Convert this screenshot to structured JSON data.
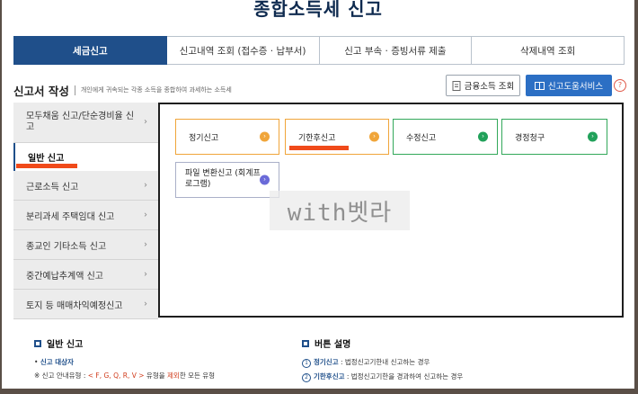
{
  "page_title": "종합소득세 신고",
  "tabs": [
    {
      "label": "세금신고"
    },
    {
      "label": "신고내역 조회 (접수증 · 납부서)"
    },
    {
      "label": "신고 부속 · 증빙서류 제출"
    },
    {
      "label": "삭제내역 조회"
    }
  ],
  "section": {
    "title": "신고서 작성",
    "desc": "개인에게 귀속되는 각종 소득을 종합하여 과세하는 소득세"
  },
  "buttons": {
    "financial_income": "금융소득 조회",
    "help_service": "신고도움서비스",
    "help_icon": "?"
  },
  "sidebar": {
    "items": [
      {
        "label": "모두채움 신고/단순경비율 신고"
      },
      {
        "label": "일반 신고"
      },
      {
        "label": "근로소득 신고"
      },
      {
        "label": "분리과세 주택임대 신고"
      },
      {
        "label": "종교인 기타소득 신고"
      },
      {
        "label": "중간예납추계액 신고"
      },
      {
        "label": "토지 등 매매차익예정신고"
      }
    ]
  },
  "options": [
    {
      "label": "정기신고"
    },
    {
      "label": "기한후신고"
    },
    {
      "label": "수정신고"
    },
    {
      "label": "경정청구"
    },
    {
      "label": "파일 변환신고 (회계프로그램)"
    }
  ],
  "watermark": "with벳라",
  "info_left": {
    "title": "일반 신고",
    "line1": "신고 대상자",
    "line2_pre": "※ 신고 안내유형 : ",
    "line2_codes": "< F, G, Q, R, V >",
    "line2_mid": " 유형을 ",
    "line2_red": "제외",
    "line2_post": "한 모든 유형"
  },
  "info_right": {
    "title": "버튼 설명",
    "line1_num": "1",
    "line1_b": "정기신고",
    "line1": " : 법정신고기한내 신고하는 경우",
    "line2_num": "2",
    "line2_b": "기한후신고",
    "line2": " : 법정신고기한을 경과하여 신고하는 경우"
  },
  "colors": {
    "primary": "#1f4f8a",
    "help_button": "#2c6fc4",
    "orange": "#f0a53a",
    "green": "#21a15a",
    "highlight": "#f04a1a"
  }
}
